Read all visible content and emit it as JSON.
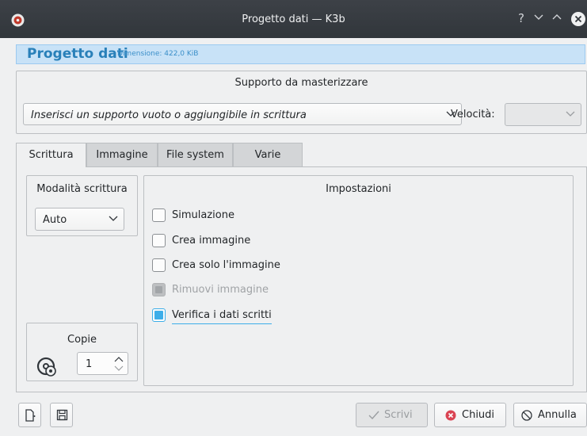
{
  "window": {
    "title": "Progetto dati — K3b",
    "controls": {
      "help": "?",
      "minimize": "⌄",
      "maximize": "⌃"
    }
  },
  "header": {
    "title": "Progetto dati",
    "dimension": "Dimensione: 422,0 KiB"
  },
  "media": {
    "caption": "Supporto da masterizzare",
    "selected": "Inserisci un supporto vuoto o aggiungibile in scrittura",
    "speed_label": "Velocità:",
    "speed_value": ""
  },
  "tabs": [
    {
      "label": "Scrittura",
      "active": true
    },
    {
      "label": "Immagine",
      "active": false
    },
    {
      "label": "File system",
      "active": false
    },
    {
      "label": "Varie",
      "active": false
    }
  ],
  "write_mode": {
    "caption": "Modalità scrittura",
    "value": "Auto"
  },
  "copies": {
    "caption": "Copie",
    "value": "1"
  },
  "settings": {
    "caption": "Impostazioni",
    "options": [
      {
        "label": "Simulazione",
        "checked": false,
        "enabled": true
      },
      {
        "label": "Crea immagine",
        "checked": false,
        "enabled": true
      },
      {
        "label": "Crea solo l'immagine",
        "checked": false,
        "enabled": true
      },
      {
        "label": "Rimuovi immagine",
        "checked": true,
        "enabled": false
      },
      {
        "label": "Verifica i dati scritti",
        "checked": true,
        "enabled": true
      }
    ]
  },
  "buttons": {
    "write": "Scrivi",
    "close": "Chiudi",
    "cancel": "Annulla"
  },
  "colors": {
    "accent": "#3daee9",
    "header_bg": "#c8e2f7",
    "titlebar": "#31363b",
    "close_icon": "#da4453"
  }
}
